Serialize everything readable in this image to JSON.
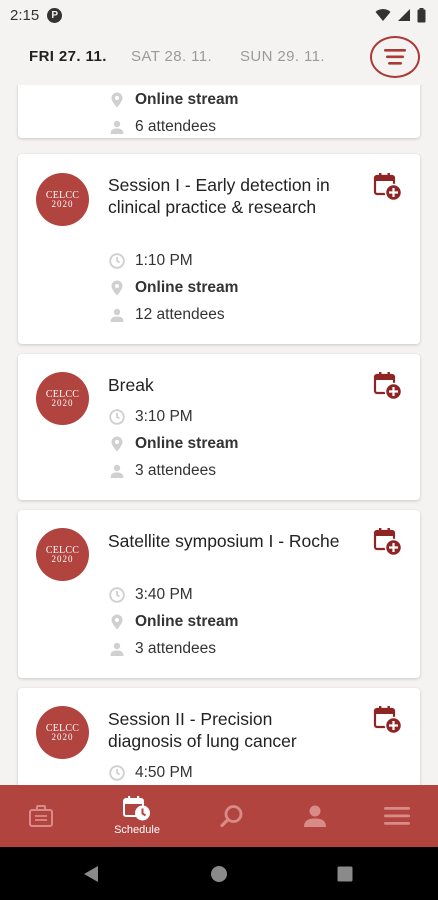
{
  "status_bar": {
    "time": "2:15",
    "app_icon_letter": "P"
  },
  "day_tabs": [
    {
      "label": "FRI 27. 11.",
      "active": true
    },
    {
      "label": "SAT 28. 11.",
      "active": false
    },
    {
      "label": "SUN 29. 11.",
      "active": false
    }
  ],
  "partial_card": {
    "location": "Online stream",
    "attendees": "6 attendees"
  },
  "sessions": [
    {
      "logo_line1": "CELCC",
      "logo_line2": "2020",
      "title": "Session I - Early detection in clinical practice & research",
      "time": "1:10 PM",
      "location": "Online stream",
      "attendees": "12 attendees"
    },
    {
      "logo_line1": "CELCC",
      "logo_line2": "2020",
      "title": "Break",
      "time": "3:10 PM",
      "location": "Online stream",
      "attendees": "3 attendees"
    },
    {
      "logo_line1": "CELCC",
      "logo_line2": "2020",
      "title": "Satellite symposium I - Roche",
      "time": "3:40 PM",
      "location": "Online stream",
      "attendees": "3 attendees"
    },
    {
      "logo_line1": "CELCC",
      "logo_line2": "2020",
      "title": "Session II - Precision diagnosis of lung cancer",
      "time": "4:50 PM"
    }
  ],
  "bottom_nav": {
    "schedule_label": "Schedule"
  },
  "colors": {
    "accent": "#b1443f",
    "accent_dark": "#8e2424",
    "background": "#f5f3f1"
  }
}
